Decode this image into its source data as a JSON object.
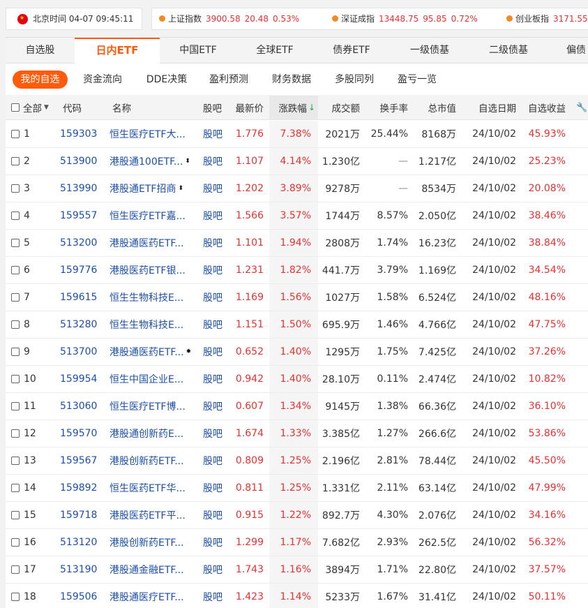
{
  "clock": {
    "label": "北京时间",
    "value": "04-07 09:45:11"
  },
  "indices": [
    {
      "name": "上证指数",
      "price": "3900.58",
      "change": "20.48",
      "pct": "0.53%"
    },
    {
      "name": "深证成指",
      "price": "13448.75",
      "change": "95.85",
      "pct": "0.72%"
    },
    {
      "name": "创业板指",
      "price": "3171.55",
      "change": "",
      "pct": ""
    }
  ],
  "tabs": [
    "自选股",
    "日内ETF",
    "中国ETF",
    "全球ETF",
    "债券ETF",
    "一级债基",
    "二级债基",
    "偏债混"
  ],
  "active_tab": 1,
  "subtabs": [
    "我的自选",
    "资金流向",
    "DDE决策",
    "盈利预测",
    "财务数据",
    "多股同列",
    "盈亏一览"
  ],
  "active_subtab": 0,
  "header": {
    "select_all": "全部",
    "code": "代码",
    "name": "名称",
    "guba": "股吧",
    "price": "最新价",
    "change_pct": "涨跌幅",
    "turnover": "成交额",
    "turnover_rate": "换手率",
    "market_cap": "总市值",
    "added_date": "自选日期",
    "return": "自选收益"
  },
  "rows": [
    {
      "no": "1",
      "code": "159303",
      "name": "恒生医疗ETF大...",
      "mark": "",
      "guba": "股吧",
      "price": "1.776",
      "pct": "7.38%",
      "turnover": "2021万",
      "rate": "25.44%",
      "cap": "8168万",
      "date": "24/10/02",
      "ret": "45.93%"
    },
    {
      "no": "2",
      "code": "513900",
      "name": "港股通100ETF...",
      "mark": "⬍",
      "guba": "股吧",
      "price": "1.107",
      "pct": "4.14%",
      "turnover": "1.230亿",
      "rate": "—",
      "cap": "1.217亿",
      "date": "24/10/02",
      "ret": "25.23%"
    },
    {
      "no": "3",
      "code": "513990",
      "name": "港股通ETF招商",
      "mark": "⬍",
      "guba": "股吧",
      "price": "1.202",
      "pct": "3.89%",
      "turnover": "9278万",
      "rate": "—",
      "cap": "8534万",
      "date": "24/10/02",
      "ret": "20.08%"
    },
    {
      "no": "4",
      "code": "159557",
      "name": "恒生医疗ETF嘉...",
      "mark": "",
      "guba": "股吧",
      "price": "1.566",
      "pct": "3.57%",
      "turnover": "1744万",
      "rate": "8.57%",
      "cap": "2.050亿",
      "date": "24/10/02",
      "ret": "38.46%"
    },
    {
      "no": "5",
      "code": "513200",
      "name": "港股通医药ETF...",
      "mark": "",
      "guba": "股吧",
      "price": "1.101",
      "pct": "1.94%",
      "turnover": "2808万",
      "rate": "1.74%",
      "cap": "16.23亿",
      "date": "24/10/02",
      "ret": "38.84%"
    },
    {
      "no": "6",
      "code": "159776",
      "name": "港股医药ETF银...",
      "mark": "",
      "guba": "股吧",
      "price": "1.231",
      "pct": "1.82%",
      "turnover": "441.7万",
      "rate": "3.79%",
      "cap": "1.169亿",
      "date": "24/10/02",
      "ret": "34.54%"
    },
    {
      "no": "7",
      "code": "159615",
      "name": "恒生生物科技E...",
      "mark": "",
      "guba": "股吧",
      "price": "1.169",
      "pct": "1.56%",
      "turnover": "1027万",
      "rate": "1.58%",
      "cap": "6.524亿",
      "date": "24/10/02",
      "ret": "48.16%"
    },
    {
      "no": "8",
      "code": "513280",
      "name": "恒生生物科技E...",
      "mark": "",
      "guba": "股吧",
      "price": "1.151",
      "pct": "1.50%",
      "turnover": "695.9万",
      "rate": "1.46%",
      "cap": "4.766亿",
      "date": "24/10/02",
      "ret": "47.75%"
    },
    {
      "no": "9",
      "code": "513700",
      "name": "港股通医药ETF...",
      "mark": "✸",
      "guba": "股吧",
      "price": "0.652",
      "pct": "1.40%",
      "turnover": "1295万",
      "rate": "1.75%",
      "cap": "7.425亿",
      "date": "24/10/02",
      "ret": "37.26%"
    },
    {
      "no": "10",
      "code": "159954",
      "name": "恒生中国企业E...",
      "mark": "",
      "guba": "股吧",
      "price": "0.942",
      "pct": "1.40%",
      "turnover": "28.10万",
      "rate": "0.11%",
      "cap": "2.474亿",
      "date": "24/10/02",
      "ret": "10.82%"
    },
    {
      "no": "11",
      "code": "513060",
      "name": "恒生医疗ETF博...",
      "mark": "",
      "guba": "股吧",
      "price": "0.607",
      "pct": "1.34%",
      "turnover": "9145万",
      "rate": "1.38%",
      "cap": "66.36亿",
      "date": "24/10/02",
      "ret": "36.10%"
    },
    {
      "no": "12",
      "code": "159570",
      "name": "港股通创新药E...",
      "mark": "",
      "guba": "股吧",
      "price": "1.674",
      "pct": "1.33%",
      "turnover": "3.385亿",
      "rate": "1.27%",
      "cap": "266.6亿",
      "date": "24/10/02",
      "ret": "53.86%"
    },
    {
      "no": "13",
      "code": "159567",
      "name": "港股创新药ETF...",
      "mark": "",
      "guba": "股吧",
      "price": "0.809",
      "pct": "1.25%",
      "turnover": "2.196亿",
      "rate": "2.81%",
      "cap": "78.44亿",
      "date": "24/10/02",
      "ret": "45.50%"
    },
    {
      "no": "14",
      "code": "159892",
      "name": "恒生医药ETF华...",
      "mark": "",
      "guba": "股吧",
      "price": "0.811",
      "pct": "1.25%",
      "turnover": "1.331亿",
      "rate": "2.11%",
      "cap": "63.14亿",
      "date": "24/10/02",
      "ret": "47.99%"
    },
    {
      "no": "15",
      "code": "159718",
      "name": "港股医药ETF平...",
      "mark": "",
      "guba": "股吧",
      "price": "0.915",
      "pct": "1.22%",
      "turnover": "892.7万",
      "rate": "4.30%",
      "cap": "2.076亿",
      "date": "24/10/02",
      "ret": "34.16%"
    },
    {
      "no": "16",
      "code": "513120",
      "name": "港股创新药ETF...",
      "mark": "",
      "guba": "股吧",
      "price": "1.299",
      "pct": "1.17%",
      "turnover": "7.682亿",
      "rate": "2.93%",
      "cap": "262.5亿",
      "date": "24/10/02",
      "ret": "56.32%"
    },
    {
      "no": "17",
      "code": "513190",
      "name": "港股通金融ETF...",
      "mark": "",
      "guba": "股吧",
      "price": "1.743",
      "pct": "1.16%",
      "turnover": "3894万",
      "rate": "1.71%",
      "cap": "22.80亿",
      "date": "24/10/02",
      "ret": "37.57%"
    },
    {
      "no": "18",
      "code": "159506",
      "name": "港股通医疗ETF...",
      "mark": "",
      "guba": "股吧",
      "price": "1.423",
      "pct": "1.14%",
      "turnover": "5233万",
      "rate": "1.67%",
      "cap": "31.41亿",
      "date": "24/10/02",
      "ret": "50.11%"
    }
  ],
  "colors": {
    "accent": "#ff5b0a",
    "up": "#e93030",
    "link": "#1c4fa8",
    "sort_down": "#22a050"
  }
}
